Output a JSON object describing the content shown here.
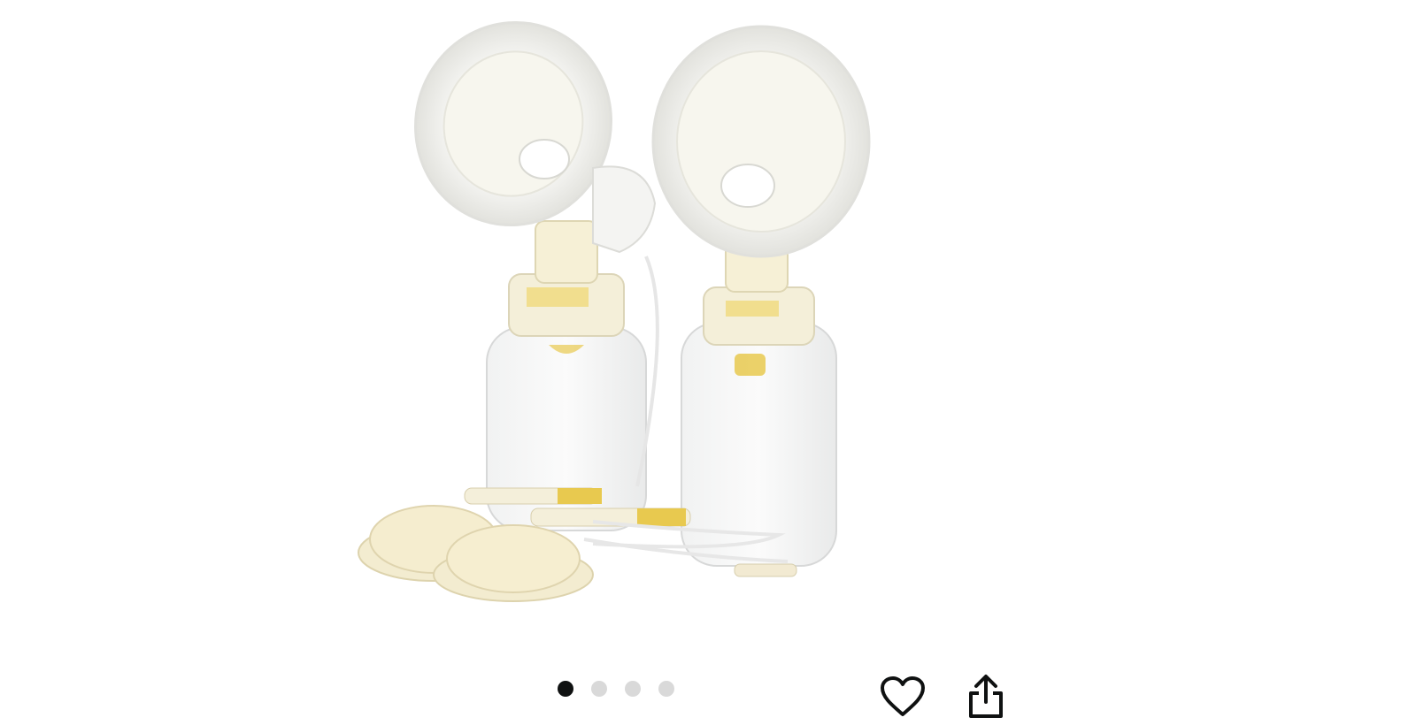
{
  "product": {
    "image_icon": "breast-pump-kit-image"
  },
  "carousel": {
    "total": 4,
    "active_index": 0
  },
  "actions": {
    "wishlist_icon": "heart-icon",
    "share_icon": "share-icon"
  },
  "colors": {
    "active_dot": "#0f1111",
    "inactive_dot": "#d9d9d9",
    "accent_yellow": "#e8c94f"
  }
}
